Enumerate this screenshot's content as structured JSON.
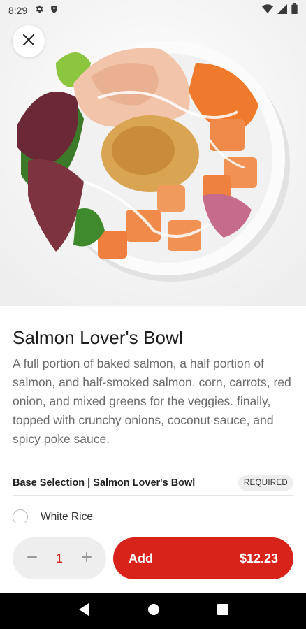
{
  "status_bar": {
    "time": "8:29",
    "left_icons": [
      "gear-icon",
      "shield-icon"
    ],
    "right_icons": [
      "wifi-icon",
      "signal-icon",
      "battery-icon"
    ]
  },
  "product": {
    "name": "Salmon Lover's Bowl",
    "description": "A full portion of baked salmon, a half portion of salmon, and half-smoked salmon. corn, carrots, red onion, and mixed greens for the veggies. finally, topped with crunchy onions, coconut sauce, and spicy poke sauce."
  },
  "options_section": {
    "title": "Base Selection | Salmon Lover's Bowl",
    "badge": "REQUIRED",
    "options": [
      {
        "label": "White Rice",
        "selected": false
      }
    ]
  },
  "cart": {
    "quantity": "1",
    "add_label": "Add",
    "price": "$12.23"
  },
  "colors": {
    "accent": "#d8231b",
    "quantity_text": "#d32a1f"
  }
}
